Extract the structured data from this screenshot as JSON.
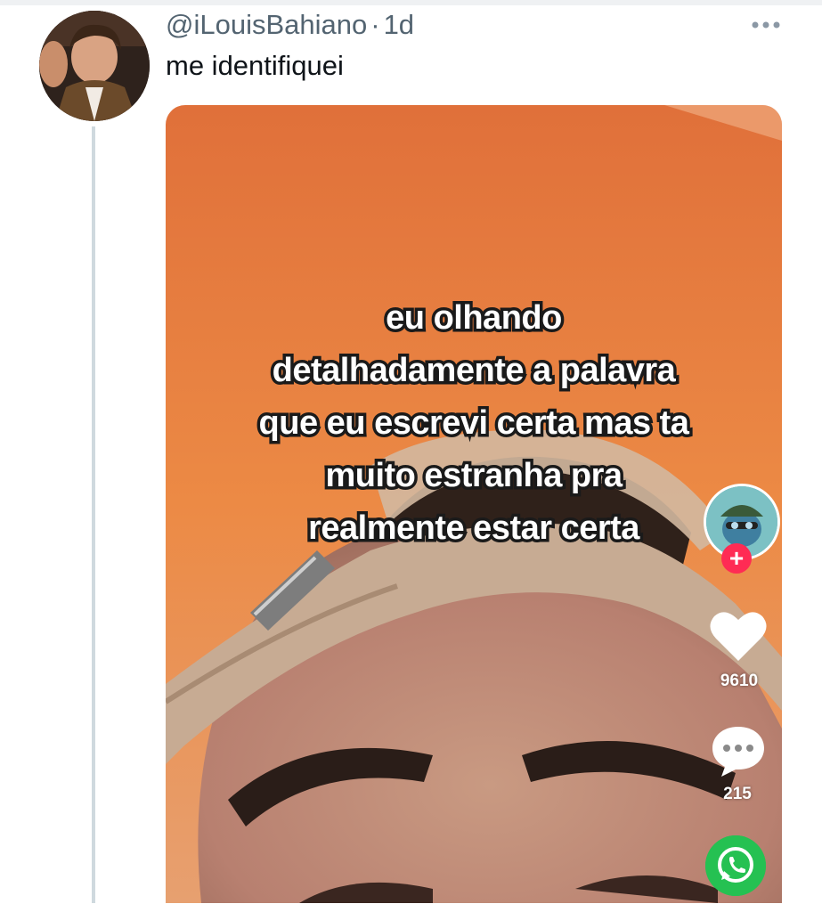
{
  "tweet": {
    "handle": "@iLouisBahiano",
    "separator": "·",
    "time": "1d",
    "text": "me identifiquei"
  },
  "video": {
    "caption_lines": [
      "eu olhando",
      "detalhadamente a palavra",
      "que eu escrevi certa mas ta",
      "muito estranha pra",
      "realmente estar certa"
    ],
    "likes": "9610",
    "comments": "215",
    "follow_symbol": "+"
  },
  "icons": {
    "more": "more-horizontal-icon",
    "like": "heart-icon",
    "comment": "comment-bubble-icon",
    "share": "whatsapp-icon"
  },
  "colors": {
    "handle_gray": "#536471",
    "text_dark": "#0f1419",
    "thread_line": "#cfd9de",
    "video_orange": "#e8783a",
    "follow_red": "#ff2b54",
    "whatsapp_green": "#25c152"
  }
}
